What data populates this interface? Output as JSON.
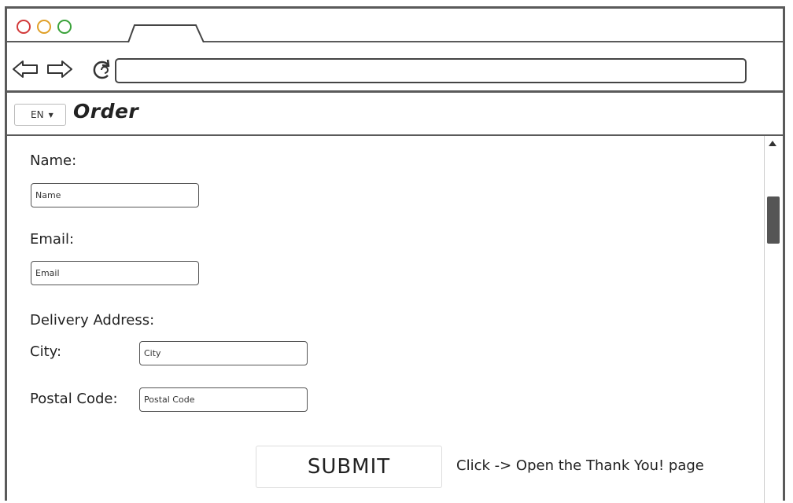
{
  "browser": {
    "url": "",
    "window_controls": [
      "close",
      "minimize",
      "maximize"
    ],
    "control_colors": {
      "close": "#d23a3a",
      "minimize": "#e0a028",
      "maximize": "#3aa23a"
    },
    "icons": {
      "back": "back-arrow-icon",
      "forward": "forward-arrow-icon",
      "refresh": "refresh-icon"
    }
  },
  "header": {
    "language": "EN",
    "title": "Order"
  },
  "form": {
    "name_label": "Name:",
    "name_placeholder": "Name",
    "email_label": "Email:",
    "email_placeholder": "Email",
    "address_label": "Delivery Address:",
    "city_label": "City:",
    "city_placeholder": "City",
    "postal_label": "Postal Code:",
    "postal_placeholder": "Postal Code",
    "submit_label": "SUBMIT",
    "submit_note": "Click -> Open the Thank You! page"
  }
}
